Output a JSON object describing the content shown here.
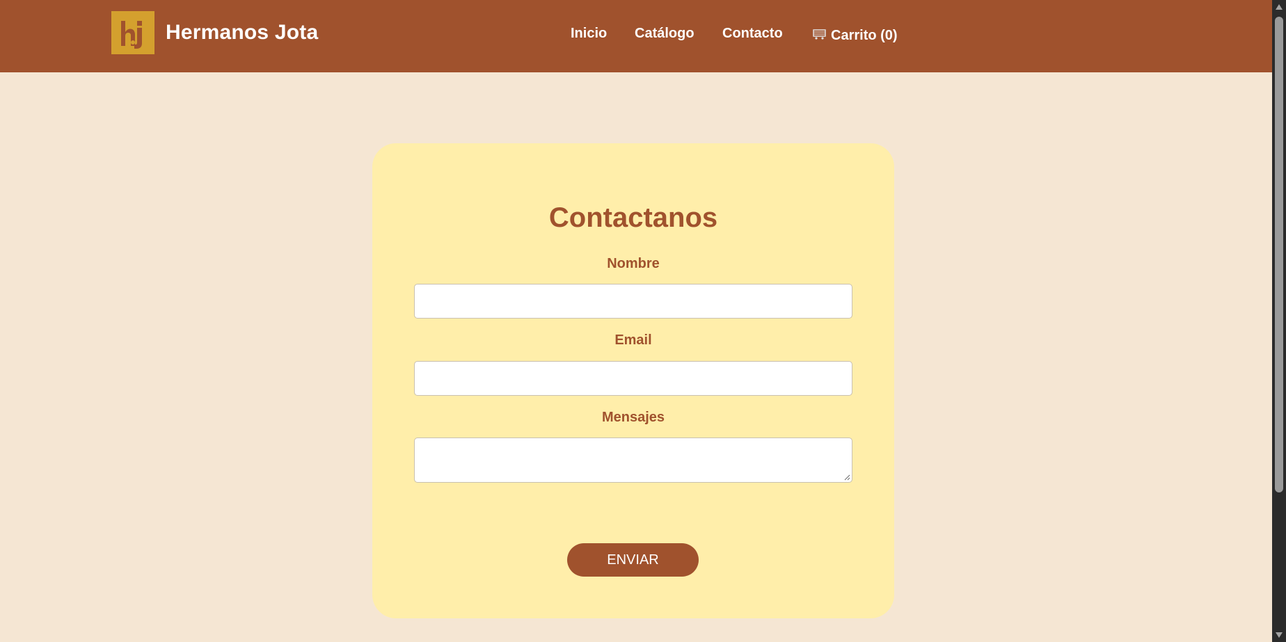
{
  "header": {
    "brand": "Hermanos Jota",
    "logo_icon": "hj-monogram-logo",
    "nav": [
      {
        "label": "Inicio"
      },
      {
        "label": "Catálogo"
      },
      {
        "label": "Contacto"
      }
    ],
    "cart": {
      "icon": "cart-icon",
      "label": "Carrito (0)"
    }
  },
  "form": {
    "title": "Contactanos",
    "name_label": "Nombre",
    "name_value": "",
    "email_label": "Email",
    "email_value": "",
    "message_label": "Mensajes",
    "message_value": "",
    "submit_label": "ENVIAR"
  },
  "colors": {
    "header_bg": "#a0522d",
    "page_bg": "#f5e6d3",
    "card_bg": "#ffeeaa",
    "logo_bg": "#d4a02e",
    "accent": "#a0522d"
  }
}
